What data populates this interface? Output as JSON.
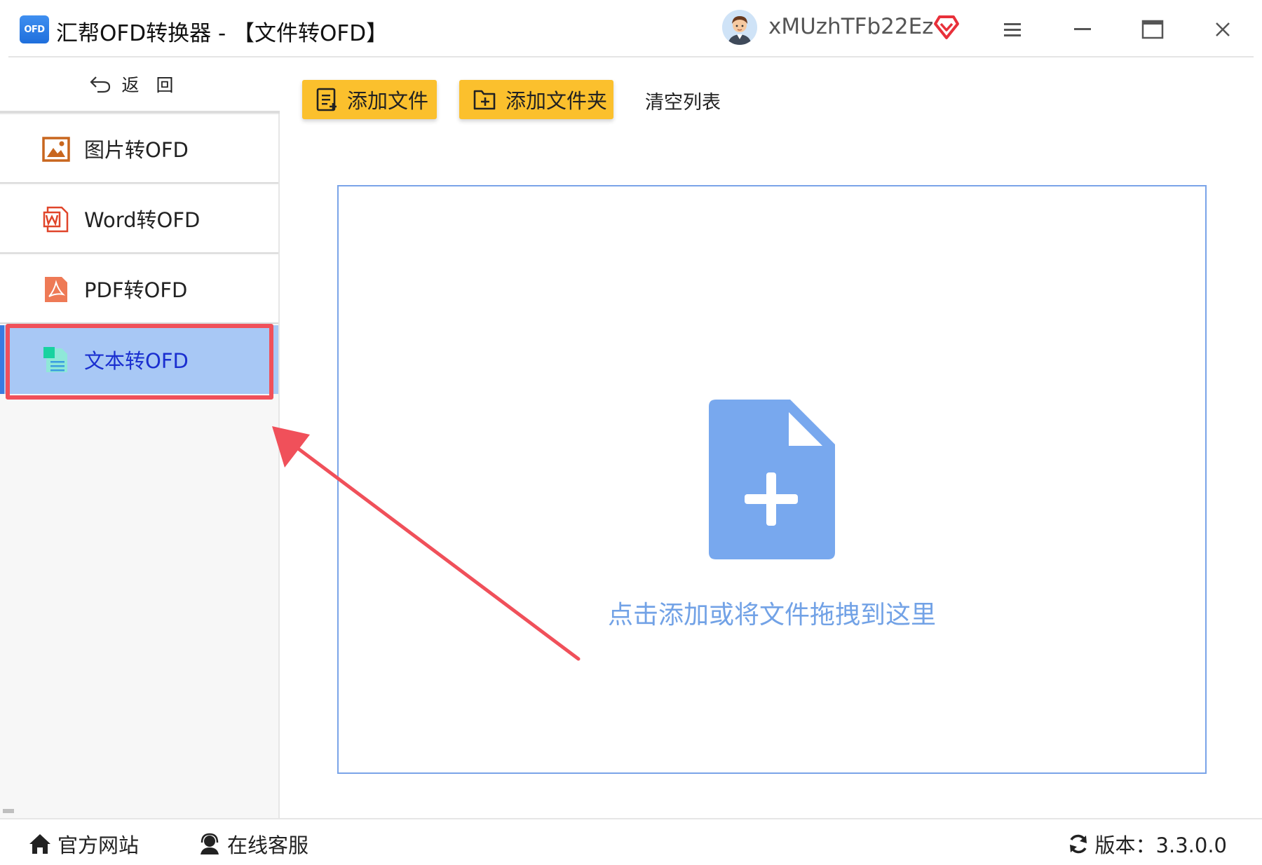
{
  "app": {
    "logo_text": "OFD",
    "title": "汇帮OFD转换器 - 【文件转OFD】",
    "username": "xMUzhTFb22Ez"
  },
  "icons": {
    "app_logo": "ofd-logo-icon",
    "avatar": "user-avatar-icon",
    "vip": "diamond-heart-icon",
    "menu": "hamburger-menu-icon",
    "minimize": "minimize-icon",
    "maximize": "maximize-icon",
    "close": "close-icon"
  },
  "sidebar": {
    "back_label": "返回",
    "items": [
      {
        "label": "图片转OFD",
        "icon": "image-icon",
        "color": "#c8661e",
        "active": false
      },
      {
        "label": "Word转OFD",
        "icon": "word-icon",
        "color": "#e0452a",
        "active": false
      },
      {
        "label": "PDF转OFD",
        "icon": "pdf-icon",
        "color": "#ee7a56",
        "active": false
      },
      {
        "label": "文本转OFD",
        "icon": "text-file-icon",
        "color": "#2fd6b0",
        "active": true
      }
    ]
  },
  "toolbar": {
    "add_file": "添加文件",
    "add_folder": "添加文件夹",
    "clear_list": "清空列表"
  },
  "dropzone": {
    "hint": "点击添加或将文件拖拽到这里"
  },
  "footer": {
    "website": "官方网站",
    "support": "在线客服",
    "version": "版本：3.3.0.0"
  },
  "colors": {
    "accent_yellow": "#fbc02d",
    "active_blue": "#a8c8f5",
    "drop_blue": "#7aa4e8",
    "annotation_red": "#f0505a"
  }
}
